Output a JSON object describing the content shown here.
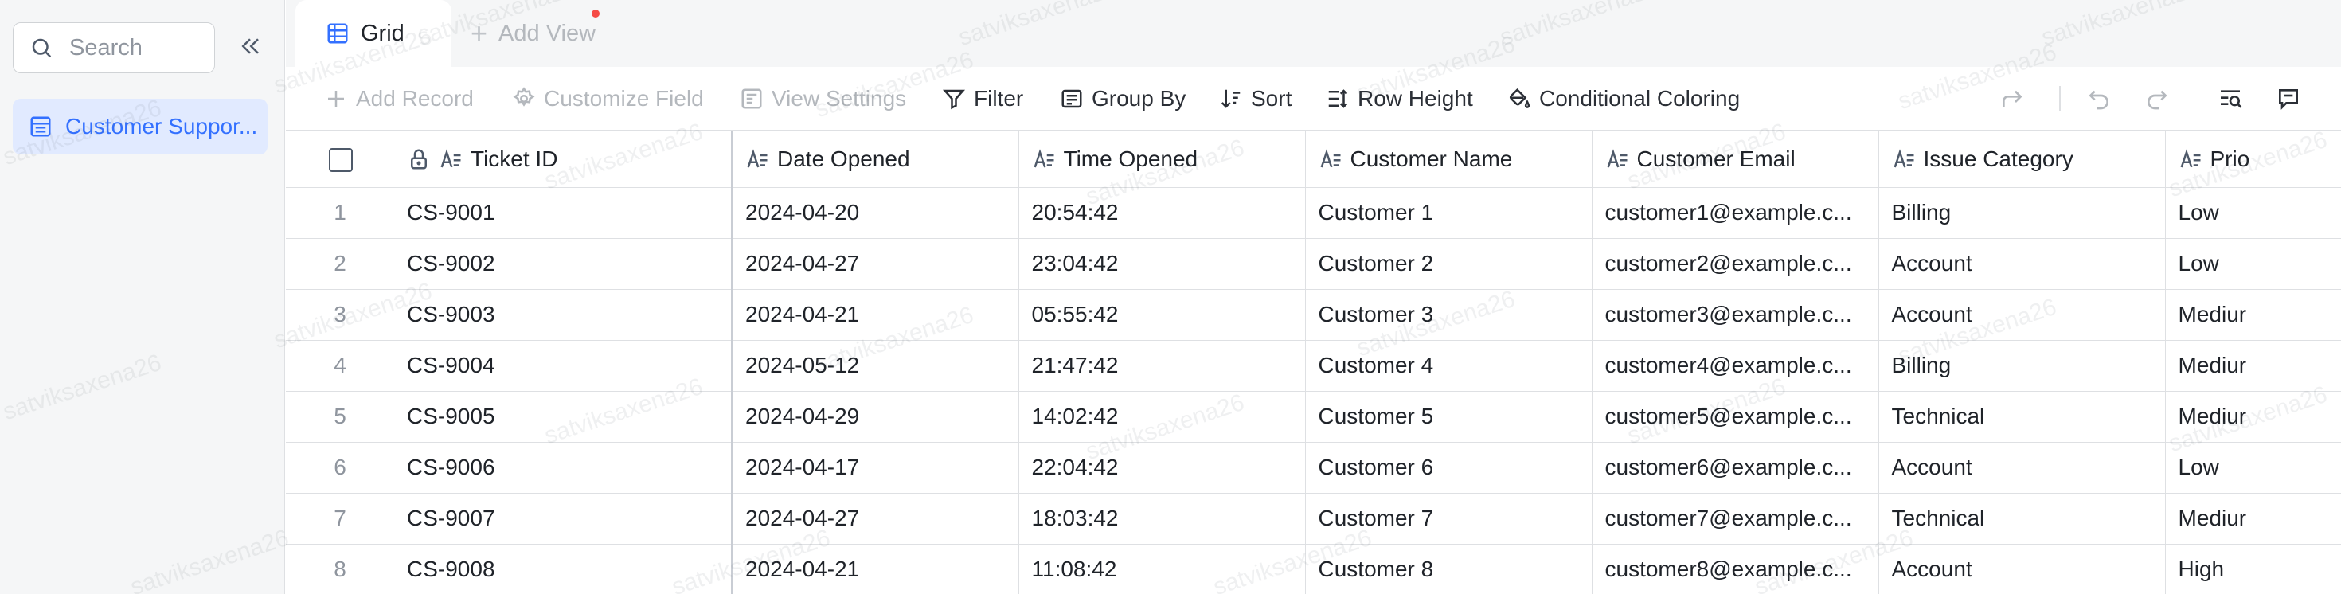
{
  "sidebar": {
    "search_placeholder": "Search",
    "tables": [
      {
        "label": "Customer Suppor..."
      }
    ]
  },
  "tabs": {
    "grid_label": "Grid",
    "add_view_label": "Add View"
  },
  "toolbar": {
    "add_record": "Add Record",
    "customize_field": "Customize Field",
    "view_settings": "View Settings",
    "filter": "Filter",
    "group_by": "Group By",
    "sort": "Sort",
    "row_height": "Row Height",
    "conditional_coloring": "Conditional Coloring"
  },
  "grid": {
    "columns": [
      "Ticket ID",
      "Date Opened",
      "Time Opened",
      "Customer Name",
      "Customer Email",
      "Issue Category",
      "Prio"
    ],
    "rows": [
      {
        "num": "1",
        "ticket": "CS-9001",
        "date": "2024-04-20",
        "time": "20:54:42",
        "name": "Customer 1",
        "email": "customer1@example.c...",
        "category": "Billing",
        "priority": "Low"
      },
      {
        "num": "2",
        "ticket": "CS-9002",
        "date": "2024-04-27",
        "time": "23:04:42",
        "name": "Customer 2",
        "email": "customer2@example.c...",
        "category": "Account",
        "priority": "Low"
      },
      {
        "num": "3",
        "ticket": "CS-9003",
        "date": "2024-04-21",
        "time": "05:55:42",
        "name": "Customer 3",
        "email": "customer3@example.c...",
        "category": "Account",
        "priority": "Mediur"
      },
      {
        "num": "4",
        "ticket": "CS-9004",
        "date": "2024-05-12",
        "time": "21:47:42",
        "name": "Customer 4",
        "email": "customer4@example.c...",
        "category": "Billing",
        "priority": "Mediur"
      },
      {
        "num": "5",
        "ticket": "CS-9005",
        "date": "2024-04-29",
        "time": "14:02:42",
        "name": "Customer 5",
        "email": "customer5@example.c...",
        "category": "Technical",
        "priority": "Mediur"
      },
      {
        "num": "6",
        "ticket": "CS-9006",
        "date": "2024-04-17",
        "time": "22:04:42",
        "name": "Customer 6",
        "email": "customer6@example.c...",
        "category": "Account",
        "priority": "Low"
      },
      {
        "num": "7",
        "ticket": "CS-9007",
        "date": "2024-04-27",
        "time": "18:03:42",
        "name": "Customer 7",
        "email": "customer7@example.c...",
        "category": "Technical",
        "priority": "Mediur"
      },
      {
        "num": "8",
        "ticket": "CS-9008",
        "date": "2024-04-21",
        "time": "11:08:42",
        "name": "Customer 8",
        "email": "customer8@example.c...",
        "category": "Account",
        "priority": "High"
      }
    ]
  },
  "watermark": "satviksaxena26",
  "colors": {
    "accent": "#3370ff",
    "selected_bg": "#e1eaff",
    "notification_dot": "#f54a45"
  }
}
